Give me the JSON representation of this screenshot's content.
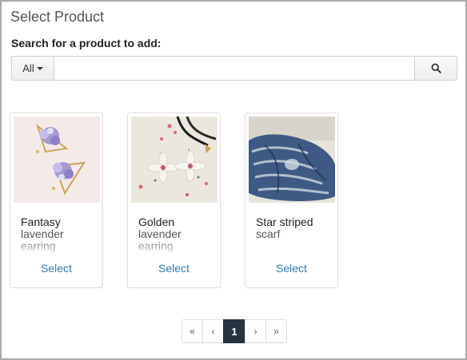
{
  "dialog": {
    "title": "Select Product",
    "search_label": "Search for a product to add:"
  },
  "search": {
    "filter_label": "All",
    "query": "",
    "placeholder": "",
    "button_icon": "search-icon"
  },
  "products": [
    {
      "name_line1": "Fantasy",
      "name_line2": "lavender",
      "name_line3": "earring",
      "select_label": "Select",
      "image": "lavender-triangle-earrings"
    },
    {
      "name_line1": "Golden",
      "name_line2": "lavender",
      "name_line3": "earring",
      "select_label": "Select",
      "image": "flower-earrings"
    },
    {
      "name_line1": "Star striped",
      "name_line2": "scarf",
      "name_line3": "",
      "select_label": "Select",
      "image": "striped-scarf"
    }
  ],
  "pagination": {
    "first": "«",
    "prev": "‹",
    "current": "1",
    "next": "›",
    "last": "»"
  },
  "colors": {
    "link": "#337ab7",
    "active_page": "#263340"
  }
}
